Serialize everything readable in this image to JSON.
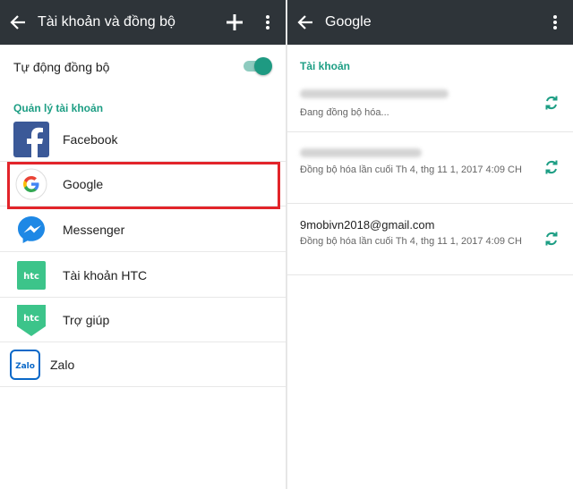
{
  "left": {
    "title": "Tài khoản và đồng bộ",
    "auto_sync_label": "Tự động đồng bộ",
    "auto_sync_on": true,
    "section_title": "Quản lý tài khoản",
    "accounts": [
      {
        "label": "Facebook",
        "icon": "facebook-icon"
      },
      {
        "label": "Google",
        "icon": "google-icon"
      },
      {
        "label": "Messenger",
        "icon": "messenger-icon"
      },
      {
        "label": "Tài khoản HTC",
        "icon": "htc-icon",
        "icon_text": "htc"
      },
      {
        "label": "Trợ giúp",
        "icon": "htc-help-icon",
        "icon_text": "htc"
      },
      {
        "label": "Zalo",
        "icon": "zalo-icon",
        "icon_text": "Zalo"
      }
    ]
  },
  "right": {
    "title": "Google",
    "section_title": "Tài khoản",
    "accounts": [
      {
        "email": "",
        "status": "Đang đồng bộ hóa..."
      },
      {
        "email": "",
        "status": "Đồng bộ hóa lần cuối Th 4, thg 11 1, 2017 4:09 CH"
      },
      {
        "email": "9mobivn2018@gmail.com",
        "status": "Đồng bộ hóa lần cuối Th 4, thg 11 1, 2017 4:09 CH"
      }
    ]
  },
  "colors": {
    "appbar": "#2e3439",
    "accent": "#1d9e84",
    "highlight": "#e2242a",
    "facebook": "#3b5998"
  }
}
